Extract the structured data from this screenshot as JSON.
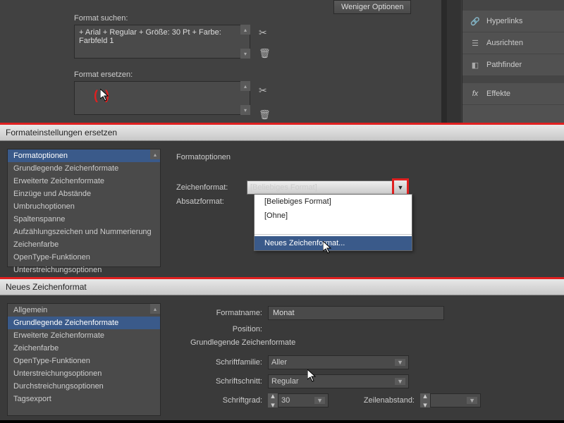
{
  "top": {
    "weniger": "Weniger Optionen",
    "suchen_label": "Format suchen:",
    "suchen_value": "+ Arial + Regular + Größe: 30 Pt + Farbe: Farbfeld 1",
    "ersetzen_label": "Format ersetzen:"
  },
  "rightPanel": {
    "items": [
      {
        "icon": "link",
        "label": "Hyperlinks"
      },
      {
        "icon": "align",
        "label": "Ausrichten"
      },
      {
        "icon": "path",
        "label": "Pathfinder"
      },
      {
        "icon": "fx",
        "label": "Effekte"
      }
    ]
  },
  "sec2": {
    "title": "Formateinstellungen ersetzen",
    "side": [
      "Formatoptionen",
      "Grundlegende Zeichenformate",
      "Erweiterte Zeichenformate",
      "Einzüge und Abstände",
      "Umbruchoptionen",
      "Spaltenspanne",
      "Aufzählungszeichen und Nummerierung",
      "Zeichenfarbe",
      "OpenType-Funktionen",
      "Unterstreichungsoptionen"
    ],
    "heading": "Formatoptionen",
    "zeichen_lbl": "Zeichenformat:",
    "absatz_lbl": "Absatzformat:",
    "dd_value": "[Beliebiges Format]",
    "menu": [
      "[Beliebiges Format]",
      "[Ohne]"
    ],
    "menu_new": "Neues Zeichenformat..."
  },
  "sec3": {
    "title": "Neues Zeichenformat",
    "side": [
      "Allgemein",
      "Grundlegende Zeichenformate",
      "Erweiterte Zeichenformate",
      "Zeichenfarbe",
      "OpenType-Funktionen",
      "Unterstreichungsoptionen",
      "Durchstreichungsoptionen",
      "Tagsexport"
    ],
    "name_lbl": "Formatname:",
    "name_val": "Monat",
    "pos_lbl": "Position:",
    "heading": "Grundlegende Zeichenformate",
    "familie_lbl": "Schriftfamilie:",
    "familie_val": "Aller",
    "schnitt_lbl": "Schriftschnitt:",
    "schnitt_val": "Regular",
    "grad_lbl": "Schriftgrad:",
    "grad_val": "30",
    "zeilen_lbl": "Zeilenabstand:"
  }
}
